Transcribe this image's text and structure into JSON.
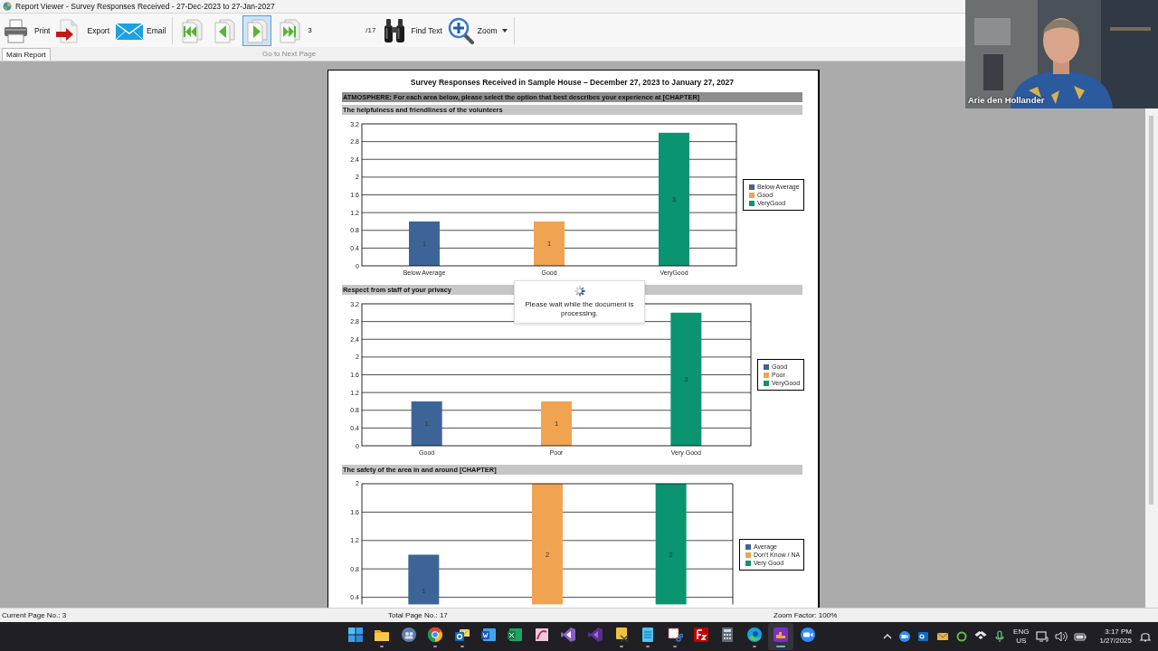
{
  "window": {
    "title": "Report Viewer - Survey Responses Received - 27-Dec-2023 to 27-Jan-2027"
  },
  "toolbar": {
    "buttons": [
      {
        "kind": "print",
        "label": "Print"
      },
      {
        "kind": "export",
        "label": "Export"
      },
      {
        "kind": "email",
        "label": "Email"
      }
    ],
    "navigation": [
      {
        "kind": "first",
        "selected": false
      },
      {
        "kind": "previous",
        "selected": false
      },
      {
        "kind": "next",
        "selected": true
      },
      {
        "kind": "last",
        "selected": false
      }
    ],
    "page_field": {
      "value": "3"
    },
    "page_total": "/17",
    "find": {
      "label": "Find Text"
    },
    "zoom": {
      "label": "Zoom"
    }
  },
  "tabs": [
    {
      "label": "Main Report",
      "selected": true
    }
  ],
  "tooltip": "Go to Next Page",
  "report": {
    "title": "Survey Responses Received  in Sample House – December 27, 2023 to January 27, 2027",
    "blocks": [
      {
        "kind": "section",
        "text": "ATMOSPHERE: For each area below, please select the option that best describes your experience at [CHAPTER]"
      },
      {
        "kind": "question",
        "text": "The helpfulness and friendliness of the volunteers"
      },
      {
        "kind": "chart",
        "chart_data": {
          "type": "bar",
          "categories": [
            "Below Average",
            "Good",
            "VeryGood"
          ],
          "series": [
            {
              "name": "Below Average",
              "color": "#3d6496",
              "values": [
                1,
                null,
                null
              ]
            },
            {
              "name": "Good",
              "color": "#f0a451",
              "values": [
                null,
                1,
                null
              ]
            },
            {
              "name": "VeryGood",
              "color": "#0a9470",
              "values": [
                null,
                null,
                3
              ]
            }
          ],
          "ylim": [
            0,
            3.2
          ],
          "yticks": [
            0,
            0.4,
            0.8,
            1.2,
            1.6,
            2,
            2.4,
            2.8,
            3.2
          ],
          "data_labels": true,
          "grid": true,
          "legend": true
        }
      },
      {
        "kind": "question",
        "text": "Respect from staff of your privacy"
      },
      {
        "kind": "chart",
        "chart_data": {
          "type": "bar",
          "categories": [
            "Good",
            "Poor",
            "Very Good"
          ],
          "series": [
            {
              "name": "Good",
              "color": "#3d6496",
              "values": [
                1,
                null,
                null
              ]
            },
            {
              "name": "Poor",
              "color": "#f0a451",
              "values": [
                null,
                1,
                null
              ]
            },
            {
              "name": "VeryGood",
              "color": "#0a9470",
              "values": [
                null,
                null,
                3
              ]
            }
          ],
          "ylim": [
            0,
            3.2
          ],
          "yticks": [
            0,
            0.4,
            0.8,
            1.2,
            1.6,
            2,
            2.4,
            2.8,
            3.2
          ],
          "data_labels": true,
          "grid": true,
          "legend": true
        }
      },
      {
        "kind": "question",
        "text": "The safety of the area in and around [CHAPTER]"
      },
      {
        "kind": "chart",
        "chart_data": {
          "type": "bar",
          "series": [
            {
              "name": "Average",
              "color": "#3d6496",
              "values": [
                1,
                null,
                null
              ]
            },
            {
              "name": "Don't Know / NA",
              "color": "#f0a451",
              "values": [
                null,
                2,
                null
              ]
            },
            {
              "name": "Very Good",
              "color": "#0a9470",
              "values": [
                null,
                null,
                2
              ]
            }
          ],
          "ylim": [
            0.3,
            2
          ],
          "yticks": [
            0.4,
            0.8,
            1.2,
            1.6,
            2
          ],
          "data_labels": true,
          "grid": true,
          "legend": true
        }
      }
    ]
  },
  "loading_message": "Please wait while the document is processing.",
  "status_bar": {
    "current_page": "Current Page No.: 3",
    "total_pages": "Total Page No.: 17",
    "zoom": "Zoom Factor: 100%"
  },
  "video": {
    "kind": "picture",
    "name": "Arie den Hollander"
  },
  "taskbar": {
    "apps": [
      {
        "running": false,
        "selected": false
      },
      {
        "running": true,
        "selected": false
      },
      {
        "running": false,
        "selected": false
      },
      {
        "running": true,
        "selected": false
      },
      {
        "running": true,
        "selected": false
      },
      {
        "running": false,
        "selected": false
      },
      {
        "running": false,
        "selected": false
      },
      {
        "running": false,
        "selected": false
      },
      {
        "running": false,
        "selected": false
      },
      {
        "running": false,
        "selected": false
      },
      {
        "running": true,
        "selected": false
      },
      {
        "running": true,
        "selected": false
      },
      {
        "running": true,
        "selected": false
      },
      {
        "running": false,
        "selected": false
      },
      {
        "running": false,
        "selected": false
      },
      {
        "running": true,
        "selected": false
      },
      {
        "running": true,
        "selected": true
      },
      {
        "running": false,
        "selected": false
      }
    ],
    "tray": {
      "language": "ENG",
      "region": "US",
      "time": "3:17 PM",
      "date": "1/27/2025"
    }
  }
}
